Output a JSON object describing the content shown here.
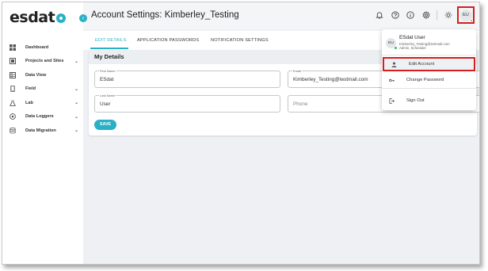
{
  "brand": {
    "name": "esdat",
    "accent": "#2ab0c5",
    "highlight": "#d61e1e"
  },
  "sidebar": {
    "items": [
      {
        "label": "Dashboard",
        "icon": "dashboard-icon",
        "expandable": false
      },
      {
        "label": "Projects and Sites",
        "icon": "projects-icon",
        "expandable": true
      },
      {
        "label": "Data View",
        "icon": "table-icon",
        "expandable": false
      },
      {
        "label": "Field",
        "icon": "phone-icon",
        "expandable": true
      },
      {
        "label": "Lab",
        "icon": "flask-icon",
        "expandable": true
      },
      {
        "label": "Data Loggers",
        "icon": "logger-icon",
        "expandable": true
      },
      {
        "label": "Data Migration",
        "icon": "database-icon",
        "expandable": true
      }
    ]
  },
  "header": {
    "title": "Account Settings: Kimberley_Testing",
    "icons": [
      "bell-icon",
      "help-icon",
      "info-icon",
      "settings-icon",
      "theme-icon"
    ],
    "avatar_initials": "EU"
  },
  "tabs": [
    {
      "label": "EDIT DETAILS",
      "active": true
    },
    {
      "label": "APPLICATION PASSWORDS",
      "active": false
    },
    {
      "label": "NOTIFICATION SETTINGS",
      "active": false
    }
  ],
  "details": {
    "heading": "My Details",
    "first_name_label": "First Name",
    "first_name_value": "ESdat",
    "email_label": "Email",
    "email_value": "Kimberley_Testing@testmail.com",
    "last_name_label": "Last Name",
    "last_name_value": "User",
    "phone_placeholder": "Phone",
    "save_label": "SAVE"
  },
  "user_menu": {
    "initials": "EU",
    "name": "ESdat User",
    "email": "Kimberley_Testing@testmail.com",
    "roles": "Admin, Scheduler",
    "items": [
      {
        "label": "Edit Account",
        "icon": "person-icon",
        "highlighted": true
      },
      {
        "label": "Change Password",
        "icon": "key-icon",
        "highlighted": false
      },
      {
        "label": "Sign Out",
        "icon": "logout-icon",
        "highlighted": false
      }
    ]
  }
}
